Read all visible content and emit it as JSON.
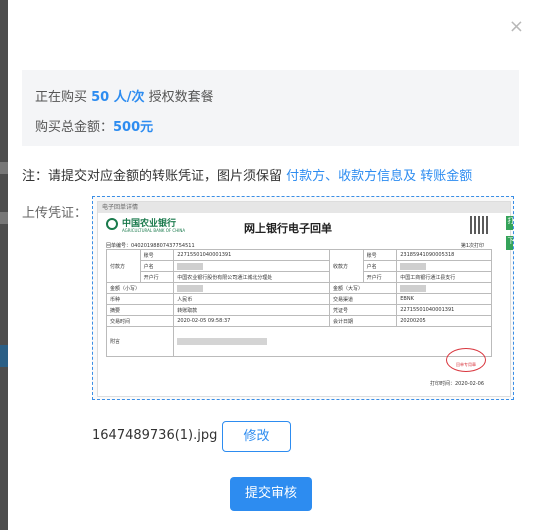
{
  "modal": {
    "close_glyph": "×",
    "summary": {
      "buying_prefix": "正在购买 ",
      "package_count": "50 人/次",
      "package_suffix": " 授权数套餐",
      "total_prefix": "购买总金额：",
      "total_amount": "500元"
    },
    "note": {
      "prefix": "注：请提交对应金额的转账凭证，图片须保留 ",
      "highlight1": "付款方、收款方信息及 ",
      "highlight2": "转账金额"
    },
    "upload_label": "上传凭证：",
    "receipt": {
      "topbar_text": "电子回单详情",
      "bank_name": "中国农业银行",
      "bank_en": "AGRICULTURAL BANK OF CHINA",
      "title": "网上银行电子回单",
      "receipt_no": "回单编号：04020198807437754511",
      "page_info": "第1次打印",
      "payer_label": "付款方",
      "payee_label": "收款方",
      "account_label": "账号",
      "name_label": "户名",
      "bank_label": "开户行",
      "payer_account": "22715501040001391",
      "payer_bank": "中国农业银行股份有限公司通江城北分理处",
      "payee_account": "23185941090005318",
      "payee_bank": "中国工商银行通江县支行",
      "amount_lower_label": "金额（小写）",
      "amount_upper_label": "金额（大写）",
      "currency_label": "币种",
      "currency": "人民币",
      "channel_label": "交易渠道",
      "channel": "EBNK",
      "summary_label": "摘要",
      "summary": "转账取款",
      "voucher_label": "凭证号",
      "voucher": "22715501040001391",
      "time_label": "交易时间",
      "time": "2020-02-05 09:58:37",
      "date_label": "会计日期",
      "date": "20200205",
      "memo_label": "附言",
      "stamp": "回单专用章",
      "print_time": "打印时间：2020-02-06",
      "side1": "打",
      "side2": "下"
    },
    "filename": "1647489736(1).jpg",
    "modify_label": "修改",
    "submit_label": "提交审核"
  }
}
